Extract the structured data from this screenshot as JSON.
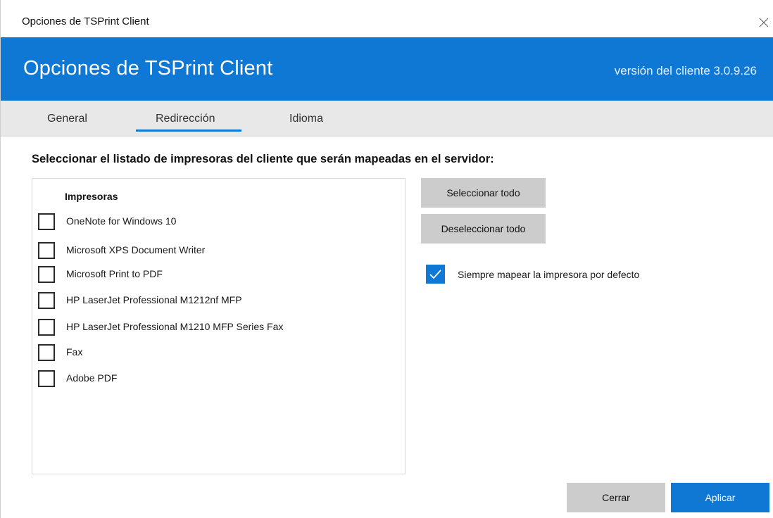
{
  "window": {
    "title": "Opciones de TSPrint Client"
  },
  "banner": {
    "heading": "Opciones de TSPrint Client",
    "version": "versión del cliente 3.0.9.26",
    "color": "#0f78d4"
  },
  "tabs": [
    {
      "label": "General",
      "active": false
    },
    {
      "label": "Redirección",
      "active": true
    },
    {
      "label": "Idioma",
      "active": false
    }
  ],
  "section_title": "Seleccionar el listado de impresoras del cliente que serán mapeadas en el servidor:",
  "printers": {
    "header": "Impresoras",
    "items": [
      {
        "label": "OneNote for Windows 10",
        "checked": false
      },
      {
        "label": "Microsoft XPS Document Writer",
        "checked": false
      },
      {
        "label": "Microsoft Print to PDF",
        "checked": false
      },
      {
        "label": "HP LaserJet Professional M1212nf MFP",
        "checked": false
      },
      {
        "label": "HP LaserJet Professional M1210 MFP Series Fax",
        "checked": false
      },
      {
        "label": "Fax",
        "checked": false
      },
      {
        "label": "Adobe PDF",
        "checked": false
      }
    ]
  },
  "buttons": {
    "select_all": "Seleccionar todo",
    "deselect_all": "Deseleccionar todo",
    "close": "Cerrar",
    "apply": "Aplicar"
  },
  "default_printer": {
    "label": "Siempre mapear la impresora por defecto",
    "checked": true
  },
  "icons": {
    "close": "close-icon",
    "check": "checkmark-icon"
  }
}
